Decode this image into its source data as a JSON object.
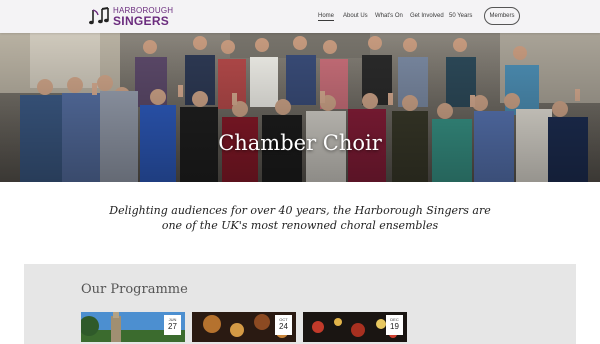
{
  "site": {
    "logo_top": "HARBOROUGH",
    "logo_bottom": "SINGERS"
  },
  "nav": {
    "items": [
      {
        "label": "Home",
        "active": true
      },
      {
        "label": "About Us",
        "active": false
      },
      {
        "label": "What's On",
        "active": false
      },
      {
        "label": "Get Involved",
        "active": false
      },
      {
        "label": "50 Years",
        "active": false
      }
    ],
    "members_label": "Members"
  },
  "hero": {
    "title": "Chamber Choir"
  },
  "tagline": "Delighting audiences for over 40 years, the Harborough Singers are one of the UK's most renowned choral ensembles",
  "programme": {
    "title": "Our Programme",
    "events": [
      {
        "month": "JUN",
        "day": "27"
      },
      {
        "month": "OCT",
        "day": "24"
      },
      {
        "month": "DEC",
        "day": "19"
      }
    ]
  },
  "colors": {
    "brand": "#6b2c7e",
    "header_bg": "#f4f3f5",
    "programme_bg": "#e6e6e6"
  }
}
